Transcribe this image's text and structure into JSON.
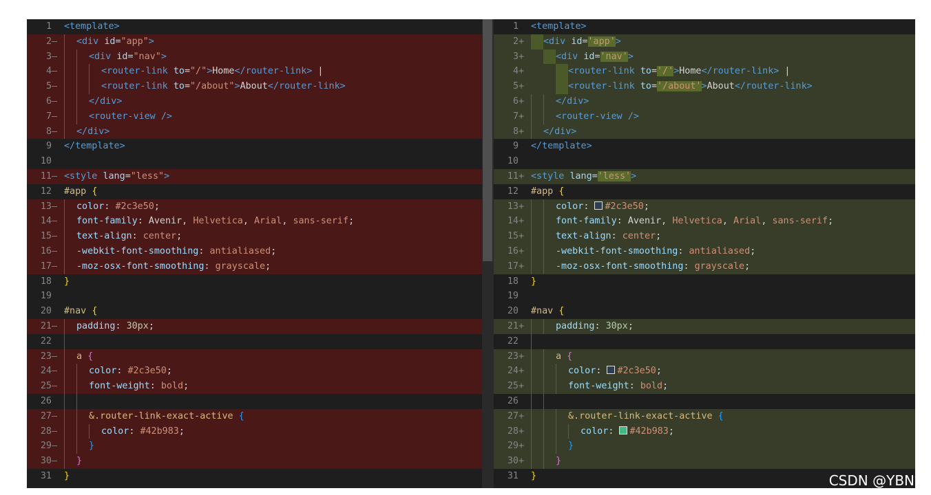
{
  "left_lines": [
    {
      "n": "1",
      "m": "",
      "chg": false,
      "toks": [
        [
          "t-tag",
          "<template>"
        ]
      ]
    },
    {
      "n": "2",
      "m": "—",
      "chg": true,
      "ind": 1,
      "toks": [
        [
          "t-tag",
          "<div "
        ],
        [
          "t-attr",
          "id"
        ],
        [
          "t-punct",
          "="
        ],
        [
          "t-str",
          "\"app\""
        ],
        [
          "t-tag",
          ">"
        ]
      ]
    },
    {
      "n": "3",
      "m": "—",
      "chg": true,
      "ind": 2,
      "toks": [
        [
          "t-tag",
          "<div "
        ],
        [
          "t-attr",
          "id"
        ],
        [
          "t-punct",
          "="
        ],
        [
          "t-str",
          "\"nav\""
        ],
        [
          "t-tag",
          ">"
        ]
      ]
    },
    {
      "n": "4",
      "m": "—",
      "chg": true,
      "ind": 3,
      "toks": [
        [
          "t-tag",
          "<router-link "
        ],
        [
          "t-attr",
          "to"
        ],
        [
          "t-punct",
          "="
        ],
        [
          "t-str",
          "\"/\""
        ],
        [
          "t-tag",
          ">"
        ],
        [
          "t-text",
          "Home"
        ],
        [
          "t-tag",
          "</router-link>"
        ],
        [
          "t-text",
          " |"
        ]
      ]
    },
    {
      "n": "5",
      "m": "—",
      "chg": true,
      "ind": 3,
      "toks": [
        [
          "t-tag",
          "<router-link "
        ],
        [
          "t-attr",
          "to"
        ],
        [
          "t-punct",
          "="
        ],
        [
          "t-str",
          "\"/about\""
        ],
        [
          "t-tag",
          ">"
        ],
        [
          "t-text",
          "About"
        ],
        [
          "t-tag",
          "</router-link>"
        ]
      ]
    },
    {
      "n": "6",
      "m": "—",
      "chg": true,
      "ind": 2,
      "toks": [
        [
          "t-tag",
          "</div>"
        ]
      ]
    },
    {
      "n": "7",
      "m": "—",
      "chg": true,
      "ind": 2,
      "toks": [
        [
          "t-tag",
          "<router-view "
        ],
        [
          "t-tag",
          "/>"
        ]
      ]
    },
    {
      "n": "8",
      "m": "—",
      "chg": true,
      "ind": 1,
      "toks": [
        [
          "t-tag",
          "</div>"
        ]
      ]
    },
    {
      "n": "9",
      "m": "",
      "chg": false,
      "toks": [
        [
          "t-tag",
          "</template>"
        ]
      ]
    },
    {
      "n": "10",
      "m": "",
      "chg": false,
      "toks": []
    },
    {
      "n": "11",
      "m": "—",
      "chg": true,
      "toks": [
        [
          "t-tag",
          "<style "
        ],
        [
          "t-attr",
          "lang"
        ],
        [
          "t-punct",
          "="
        ],
        [
          "t-str",
          "\"less\""
        ],
        [
          "t-tag",
          ">"
        ]
      ]
    },
    {
      "n": "12",
      "m": "",
      "chg": false,
      "toks": [
        [
          "t-sel",
          "#app"
        ],
        [
          "t-text",
          " "
        ],
        [
          "t-br1",
          "{"
        ]
      ]
    },
    {
      "n": "13",
      "m": "—",
      "chg": true,
      "ind": 1,
      "toks": [
        [
          "t-prop",
          "color"
        ],
        [
          "t-punct",
          ": "
        ],
        [
          "t-val",
          "#2c3e50"
        ],
        [
          "t-punct",
          ";"
        ]
      ]
    },
    {
      "n": "14",
      "m": "—",
      "chg": true,
      "ind": 1,
      "toks": [
        [
          "t-prop",
          "font-family"
        ],
        [
          "t-punct",
          ": "
        ],
        [
          "t-text",
          "Avenir, "
        ],
        [
          "t-val",
          "Helvetica"
        ],
        [
          "t-punct",
          ", "
        ],
        [
          "t-val",
          "Arial"
        ],
        [
          "t-punct",
          ", "
        ],
        [
          "t-val",
          "sans-serif"
        ],
        [
          "t-punct",
          ";"
        ]
      ]
    },
    {
      "n": "15",
      "m": "—",
      "chg": true,
      "ind": 1,
      "toks": [
        [
          "t-prop",
          "text-align"
        ],
        [
          "t-punct",
          ": "
        ],
        [
          "t-val",
          "center"
        ],
        [
          "t-punct",
          ";"
        ]
      ]
    },
    {
      "n": "16",
      "m": "—",
      "chg": true,
      "ind": 1,
      "toks": [
        [
          "t-prop",
          "-webkit-font-smoothing"
        ],
        [
          "t-punct",
          ": "
        ],
        [
          "t-val",
          "antialiased"
        ],
        [
          "t-punct",
          ";"
        ]
      ]
    },
    {
      "n": "17",
      "m": "—",
      "chg": true,
      "ind": 1,
      "toks": [
        [
          "t-prop",
          "-moz-osx-font-smoothing"
        ],
        [
          "t-punct",
          ": "
        ],
        [
          "t-val",
          "grayscale"
        ],
        [
          "t-punct",
          ";"
        ]
      ]
    },
    {
      "n": "18",
      "m": "",
      "chg": false,
      "toks": [
        [
          "t-br1",
          "}"
        ]
      ]
    },
    {
      "n": "19",
      "m": "",
      "chg": false,
      "toks": []
    },
    {
      "n": "20",
      "m": "",
      "chg": false,
      "toks": [
        [
          "t-sel",
          "#nav"
        ],
        [
          "t-text",
          " "
        ],
        [
          "t-br1",
          "{"
        ]
      ]
    },
    {
      "n": "21",
      "m": "—",
      "chg": true,
      "ind": 1,
      "toks": [
        [
          "t-prop",
          "padding"
        ],
        [
          "t-punct",
          ": "
        ],
        [
          "t-num",
          "30px"
        ],
        [
          "t-punct",
          ";"
        ]
      ]
    },
    {
      "n": "22",
      "m": "",
      "chg": false,
      "ind": 1,
      "toks": []
    },
    {
      "n": "23",
      "m": "—",
      "chg": true,
      "ind": 1,
      "toks": [
        [
          "t-sel",
          "a "
        ],
        [
          "t-br2",
          "{"
        ]
      ]
    },
    {
      "n": "24",
      "m": "—",
      "chg": true,
      "ind": 2,
      "toks": [
        [
          "t-prop",
          "color"
        ],
        [
          "t-punct",
          ": "
        ],
        [
          "t-val",
          "#2c3e50"
        ],
        [
          "t-punct",
          ";"
        ]
      ]
    },
    {
      "n": "25",
      "m": "—",
      "chg": true,
      "ind": 2,
      "toks": [
        [
          "t-prop",
          "font-weight"
        ],
        [
          "t-punct",
          ": "
        ],
        [
          "t-val",
          "bold"
        ],
        [
          "t-punct",
          ";"
        ]
      ]
    },
    {
      "n": "26",
      "m": "",
      "chg": false,
      "ind": 2,
      "toks": []
    },
    {
      "n": "27",
      "m": "—",
      "chg": true,
      "ind": 2,
      "toks": [
        [
          "t-sel",
          "&.router-link-exact-active "
        ],
        [
          "t-br3",
          "{"
        ]
      ]
    },
    {
      "n": "28",
      "m": "—",
      "chg": true,
      "ind": 3,
      "toks": [
        [
          "t-prop",
          "color"
        ],
        [
          "t-punct",
          ": "
        ],
        [
          "t-val",
          "#42b983"
        ],
        [
          "t-punct",
          ";"
        ]
      ]
    },
    {
      "n": "29",
      "m": "—",
      "chg": true,
      "ind": 2,
      "toks": [
        [
          "t-br3",
          "}"
        ]
      ]
    },
    {
      "n": "30",
      "m": "—",
      "chg": true,
      "ind": 1,
      "toks": [
        [
          "t-br2",
          "}"
        ]
      ]
    },
    {
      "n": "31",
      "m": "",
      "chg": false,
      "toks": [
        [
          "t-br1",
          "}"
        ]
      ]
    }
  ],
  "right_lines": [
    {
      "n": "1",
      "m": "",
      "chg": false,
      "toks": [
        [
          "t-tag",
          "<template>"
        ]
      ]
    },
    {
      "n": "2",
      "m": "+",
      "chg": true,
      "ind": 1,
      "hl": 1,
      "toks": [
        [
          "t-tag",
          "<div "
        ],
        [
          "t-attr",
          "id"
        ],
        [
          "t-punct",
          "="
        ],
        [
          "t-strh",
          "'app'"
        ],
        [
          "t-tag",
          ">"
        ]
      ]
    },
    {
      "n": "3",
      "m": "+",
      "chg": true,
      "ind": 2,
      "hl": 1,
      "toks": [
        [
          "t-tag",
          "<div "
        ],
        [
          "t-attr",
          "id"
        ],
        [
          "t-punct",
          "="
        ],
        [
          "t-strh",
          "'nav'"
        ],
        [
          "t-tag",
          ">"
        ]
      ]
    },
    {
      "n": "4",
      "m": "+",
      "chg": true,
      "ind": 3,
      "hl": 1,
      "toks": [
        [
          "t-tag",
          "<router-link "
        ],
        [
          "t-attr",
          "to"
        ],
        [
          "t-punct",
          "="
        ],
        [
          "t-strh",
          "'/'"
        ],
        [
          "t-tag",
          ">"
        ],
        [
          "t-text",
          "Home"
        ],
        [
          "t-tag",
          "</router-link>"
        ],
        [
          "t-text",
          " |"
        ]
      ]
    },
    {
      "n": "5",
      "m": "+",
      "chg": true,
      "ind": 3,
      "hl": 1,
      "toks": [
        [
          "t-tag",
          "<router-link "
        ],
        [
          "t-attr",
          "to"
        ],
        [
          "t-punct",
          "="
        ],
        [
          "t-strh",
          "'/about'"
        ],
        [
          "t-tag",
          ">"
        ],
        [
          "t-text",
          "About"
        ],
        [
          "t-tag",
          "</router-link>"
        ]
      ]
    },
    {
      "n": "6",
      "m": "+",
      "chg": true,
      "ind": 2,
      "toks": [
        [
          "t-tag",
          "</div>"
        ]
      ]
    },
    {
      "n": "7",
      "m": "+",
      "chg": true,
      "ind": 2,
      "toks": [
        [
          "t-tag",
          "<router-view "
        ],
        [
          "t-tag",
          "/>"
        ]
      ]
    },
    {
      "n": "8",
      "m": "+",
      "chg": true,
      "ind": 1,
      "toks": [
        [
          "t-tag",
          "</div>"
        ]
      ]
    },
    {
      "n": "9",
      "m": "",
      "chg": false,
      "toks": [
        [
          "t-tag",
          "</template>"
        ]
      ]
    },
    {
      "n": "10",
      "m": "",
      "chg": false,
      "toks": []
    },
    {
      "n": "11",
      "m": "+",
      "chg": true,
      "toks": [
        [
          "t-tag",
          "<style "
        ],
        [
          "t-attr",
          "lang"
        ],
        [
          "t-punct",
          "="
        ],
        [
          "t-strh",
          "'less'"
        ],
        [
          "t-tag",
          ">"
        ]
      ]
    },
    {
      "n": "12",
      "m": "",
      "chg": false,
      "toks": [
        [
          "t-sel",
          "#app"
        ],
        [
          "t-text",
          " "
        ],
        [
          "t-br1",
          "{"
        ]
      ]
    },
    {
      "n": "13",
      "m": "+",
      "chg": true,
      "ind": 2,
      "toks": [
        [
          "t-prop",
          "color"
        ],
        [
          "t-punct",
          ": "
        ],
        [
          "sw",
          "#2c3e50"
        ],
        [
          "t-val",
          "#2c3e50"
        ],
        [
          "t-punct",
          ";"
        ]
      ]
    },
    {
      "n": "14",
      "m": "+",
      "chg": true,
      "ind": 2,
      "toks": [
        [
          "t-prop",
          "font-family"
        ],
        [
          "t-punct",
          ": "
        ],
        [
          "t-text",
          "Avenir, "
        ],
        [
          "t-val",
          "Helvetica"
        ],
        [
          "t-punct",
          ", "
        ],
        [
          "t-val",
          "Arial"
        ],
        [
          "t-punct",
          ", "
        ],
        [
          "t-val",
          "sans-serif"
        ],
        [
          "t-punct",
          ";"
        ]
      ]
    },
    {
      "n": "15",
      "m": "+",
      "chg": true,
      "ind": 2,
      "toks": [
        [
          "t-prop",
          "text-align"
        ],
        [
          "t-punct",
          ": "
        ],
        [
          "t-val",
          "center"
        ],
        [
          "t-punct",
          ";"
        ]
      ]
    },
    {
      "n": "16",
      "m": "+",
      "chg": true,
      "ind": 2,
      "toks": [
        [
          "t-prop",
          "-webkit-font-smoothing"
        ],
        [
          "t-punct",
          ": "
        ],
        [
          "t-val",
          "antialiased"
        ],
        [
          "t-punct",
          ";"
        ]
      ]
    },
    {
      "n": "17",
      "m": "+",
      "chg": true,
      "ind": 2,
      "toks": [
        [
          "t-prop",
          "-moz-osx-font-smoothing"
        ],
        [
          "t-punct",
          ": "
        ],
        [
          "t-val",
          "grayscale"
        ],
        [
          "t-punct",
          ";"
        ]
      ]
    },
    {
      "n": "18",
      "m": "",
      "chg": false,
      "toks": [
        [
          "t-br1",
          "}"
        ]
      ]
    },
    {
      "n": "19",
      "m": "",
      "chg": false,
      "toks": []
    },
    {
      "n": "20",
      "m": "",
      "chg": false,
      "toks": [
        [
          "t-sel",
          "#nav"
        ],
        [
          "t-text",
          " "
        ],
        [
          "t-br1",
          "{"
        ]
      ]
    },
    {
      "n": "21",
      "m": "+",
      "chg": true,
      "ind": 2,
      "toks": [
        [
          "t-prop",
          "padding"
        ],
        [
          "t-punct",
          ": "
        ],
        [
          "t-num",
          "30px"
        ],
        [
          "t-punct",
          ";"
        ]
      ]
    },
    {
      "n": "22",
      "m": "",
      "chg": false,
      "ind": 1,
      "toks": []
    },
    {
      "n": "23",
      "m": "+",
      "chg": true,
      "ind": 2,
      "toks": [
        [
          "t-sel",
          "a "
        ],
        [
          "t-br2",
          "{"
        ]
      ]
    },
    {
      "n": "24",
      "m": "+",
      "chg": true,
      "ind": 3,
      "toks": [
        [
          "t-prop",
          "color"
        ],
        [
          "t-punct",
          ": "
        ],
        [
          "sw",
          "#2c3e50"
        ],
        [
          "t-val",
          "#2c3e50"
        ],
        [
          "t-punct",
          ";"
        ]
      ]
    },
    {
      "n": "25",
      "m": "+",
      "chg": true,
      "ind": 3,
      "toks": [
        [
          "t-prop",
          "font-weight"
        ],
        [
          "t-punct",
          ": "
        ],
        [
          "t-val",
          "bold"
        ],
        [
          "t-punct",
          ";"
        ]
      ]
    },
    {
      "n": "26",
      "m": "",
      "chg": false,
      "ind": 2,
      "toks": []
    },
    {
      "n": "27",
      "m": "+",
      "chg": true,
      "ind": 3,
      "toks": [
        [
          "t-sel",
          "&.router-link-exact-active "
        ],
        [
          "t-br3",
          "{"
        ]
      ]
    },
    {
      "n": "28",
      "m": "+",
      "chg": true,
      "ind": 4,
      "toks": [
        [
          "t-prop",
          "color"
        ],
        [
          "t-punct",
          ": "
        ],
        [
          "sw",
          "#42b983"
        ],
        [
          "t-val",
          "#42b983"
        ],
        [
          "t-punct",
          ";"
        ]
      ]
    },
    {
      "n": "29",
      "m": "+",
      "chg": true,
      "ind": 3,
      "toks": [
        [
          "t-br3",
          "}"
        ]
      ]
    },
    {
      "n": "30",
      "m": "+",
      "chg": true,
      "ind": 2,
      "toks": [
        [
          "t-br2",
          "}"
        ]
      ]
    },
    {
      "n": "31",
      "m": "",
      "chg": false,
      "toks": [
        [
          "t-br1",
          "}"
        ]
      ]
    }
  ],
  "colors": {
    "removed_line_bg": "#4b1818",
    "added_line_bg": "#373d29",
    "editor_bg": "#1e1e1e"
  },
  "watermark": "CSDN @YBN娜"
}
